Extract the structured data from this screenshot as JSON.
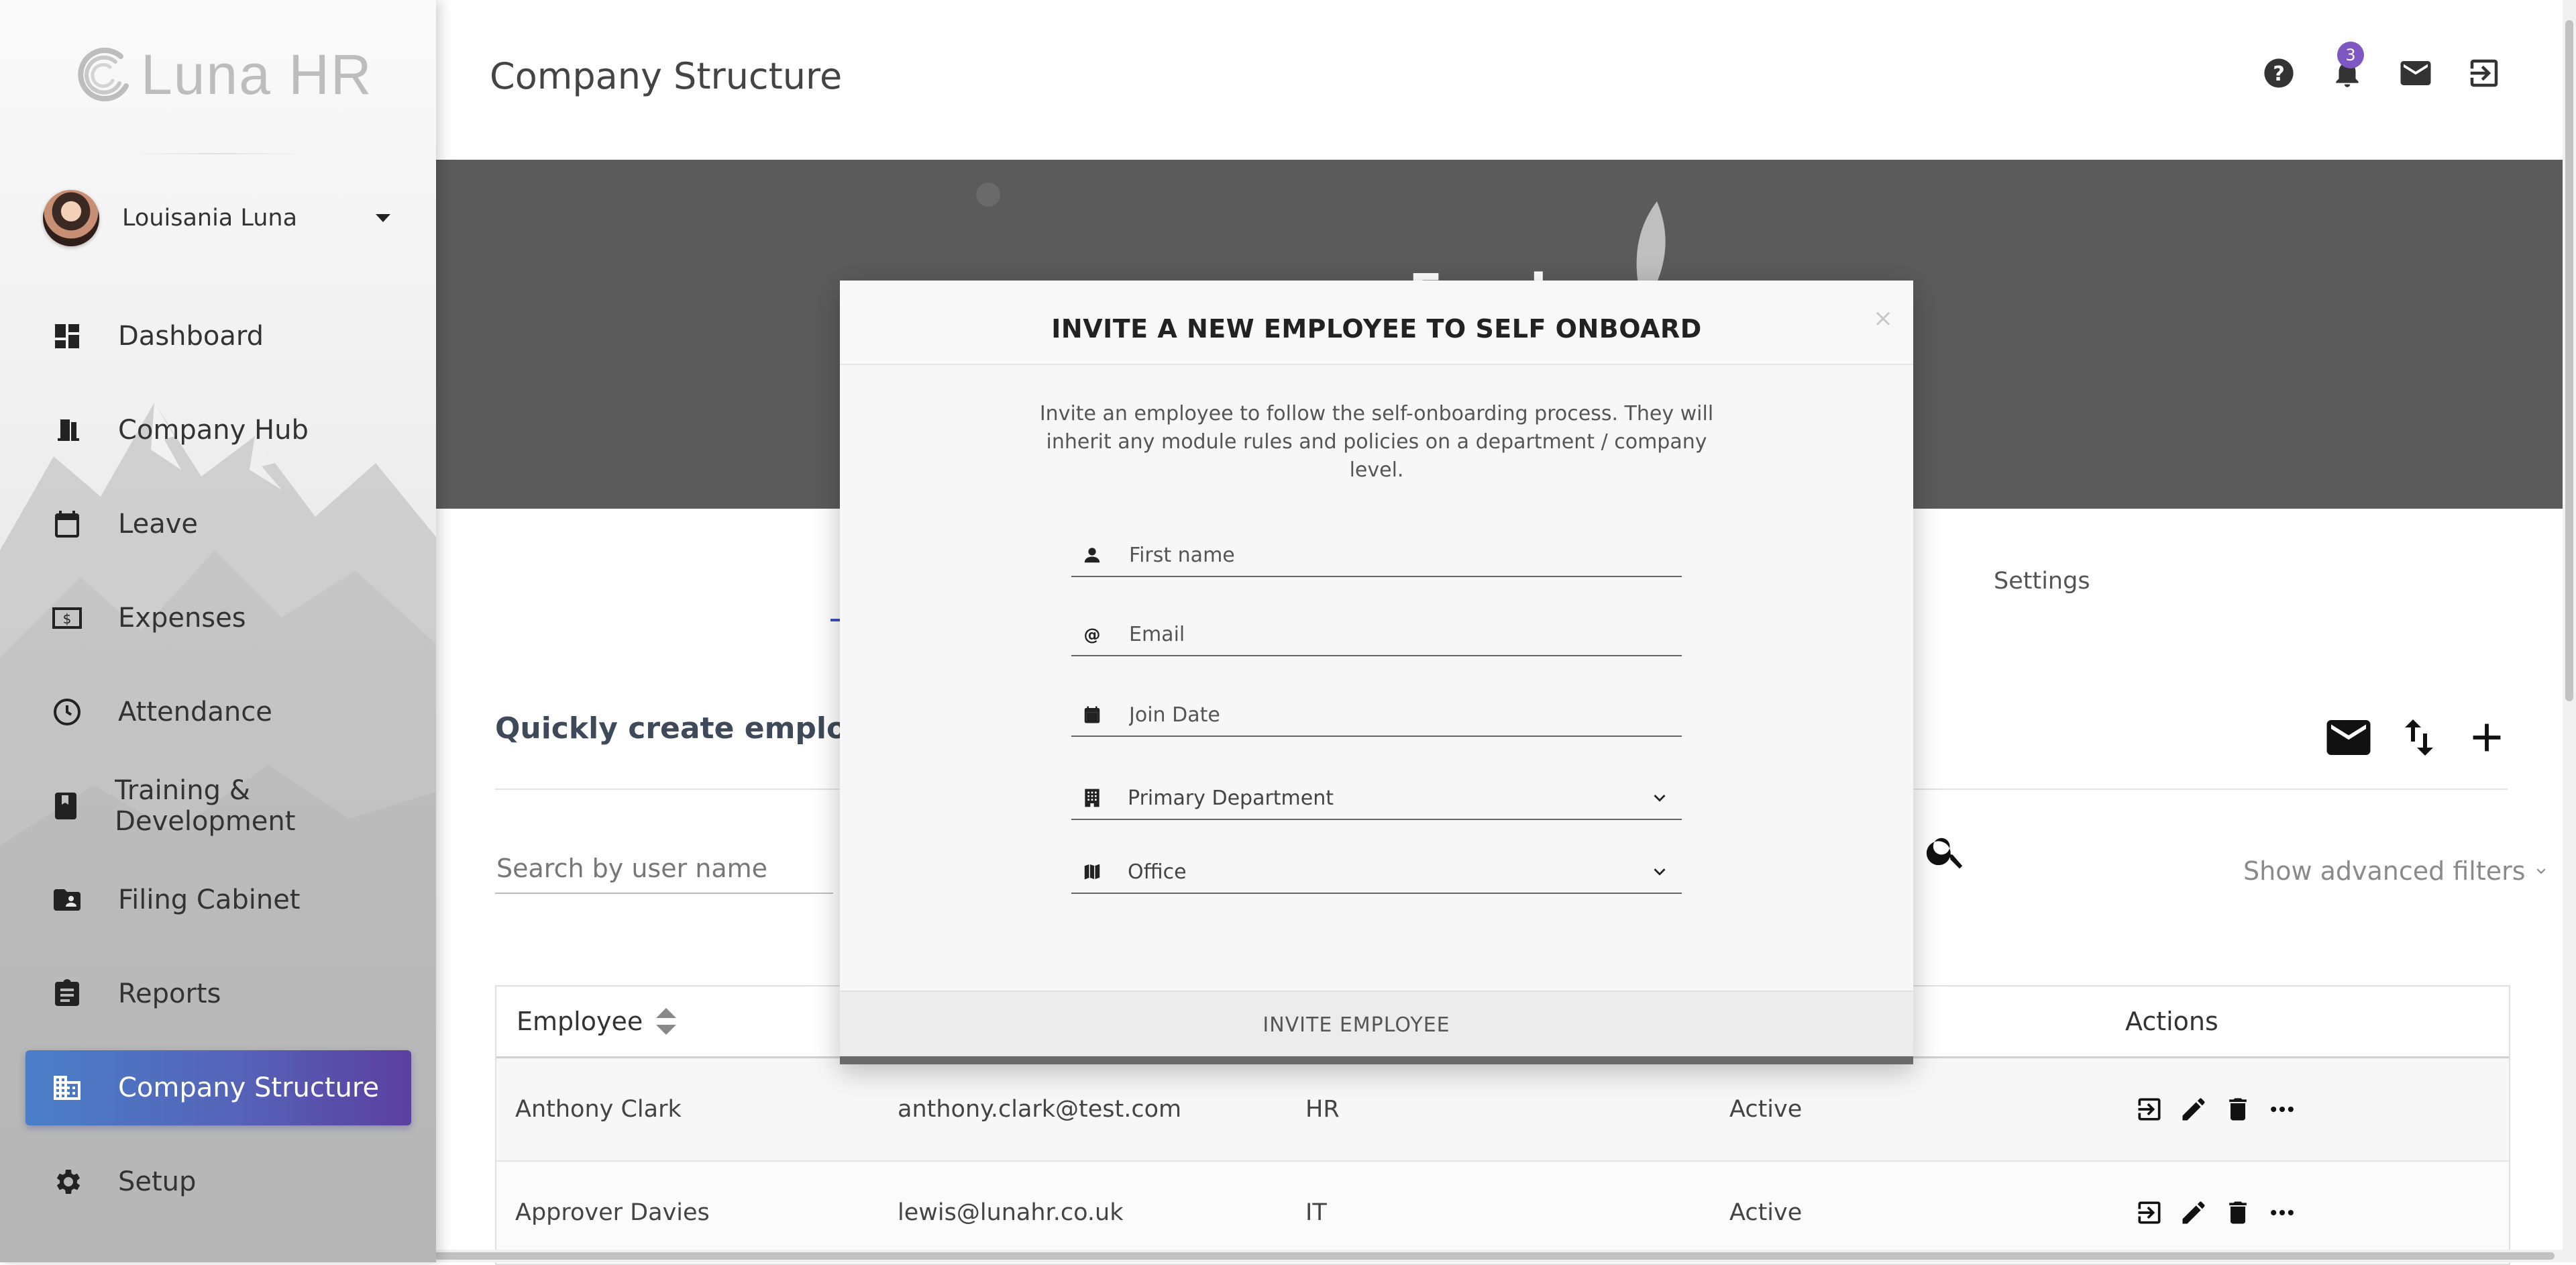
{
  "app": {
    "logo_text": "Luna HR"
  },
  "user": {
    "name": "Louisania Luna"
  },
  "sidebar": {
    "items": [
      {
        "label": "Dashboard",
        "icon": "dashboard-icon"
      },
      {
        "label": "Company Hub",
        "icon": "door-icon"
      },
      {
        "label": "Leave",
        "icon": "calendar-icon"
      },
      {
        "label": "Expenses",
        "icon": "money-icon"
      },
      {
        "label": "Attendance",
        "icon": "clock-icon"
      },
      {
        "label": "Training & Development",
        "icon": "book-icon"
      },
      {
        "label": "Filing Cabinet",
        "icon": "folder-shared-icon"
      },
      {
        "label": "Reports",
        "icon": "clipboard-icon"
      },
      {
        "label": "Company Structure",
        "icon": "domain-icon",
        "active": true
      },
      {
        "label": "Setup",
        "icon": "gear-icon"
      }
    ],
    "active_gradient": [
      "#4a7fc8",
      "#5b3fa0"
    ]
  },
  "header": {
    "title": "Company Structure",
    "notification_count": "3",
    "icons": [
      "help-icon",
      "bell-icon",
      "mail-icon",
      "logout-icon"
    ]
  },
  "banner": {
    "title": "Emplo"
  },
  "tabs": {
    "settings_label": "Settings"
  },
  "main": {
    "quick_title": "Quickly create employees",
    "search_placeholder": "Search by user name",
    "advanced_filters": "Show advanced filters"
  },
  "table": {
    "headers": {
      "employee": "Employee",
      "actions": "Actions"
    },
    "rows": [
      {
        "name": "Anthony Clark",
        "email": "anthony.clark@test.com",
        "department": "HR",
        "status": "Active"
      },
      {
        "name": "Approver Davies",
        "email": "lewis@lunahr.co.uk",
        "department": "IT",
        "status": "Active"
      }
    ]
  },
  "modal": {
    "title": "INVITE A NEW EMPLOYEE TO SELF ONBOARD",
    "close": "×",
    "description": "Invite an employee to follow the self-onboarding process. They will inherit any module rules and policies on a department / company level.",
    "fields": {
      "first_name_placeholder": "First name",
      "email_placeholder": "Email",
      "join_date_placeholder": "Join Date",
      "department_value": "Primary Department",
      "office_value": "Office"
    },
    "submit_label": "INVITE EMPLOYEE"
  }
}
